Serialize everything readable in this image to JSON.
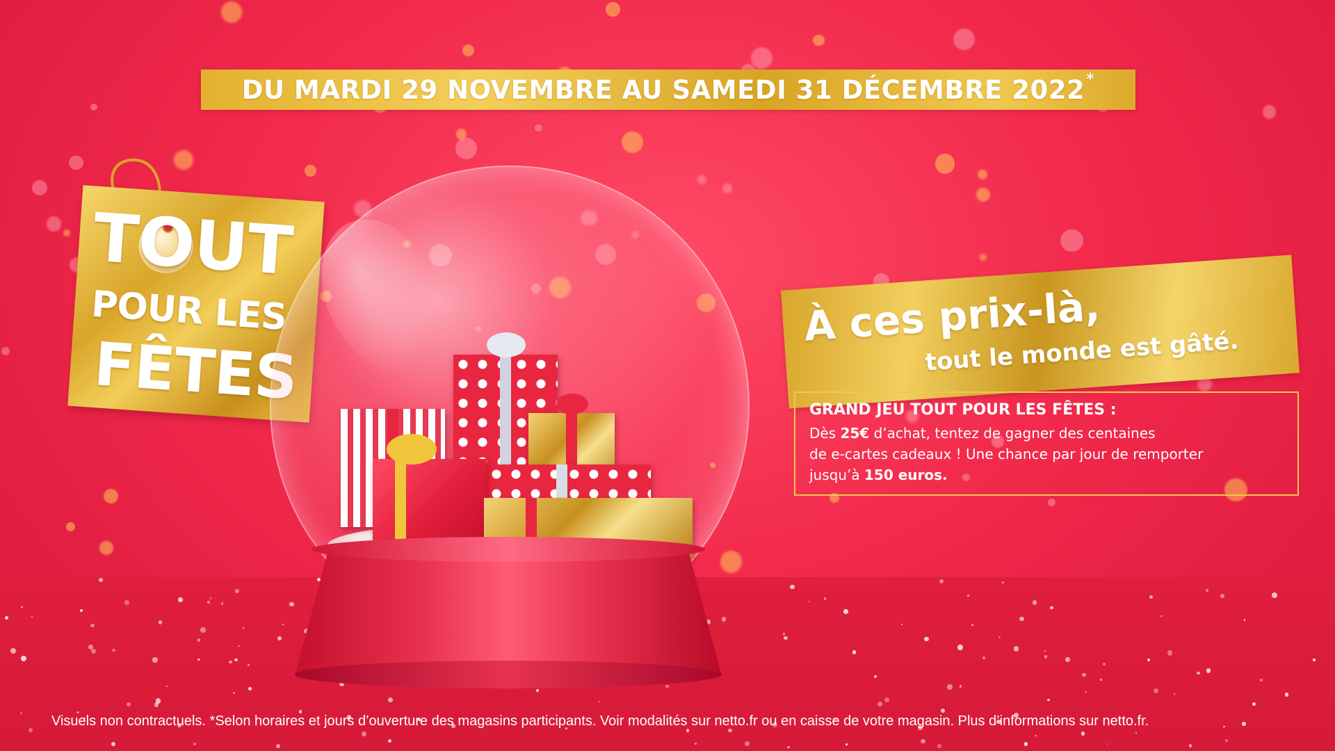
{
  "banner": {
    "date_text": "DU MARDI 29 NOVEMBRE AU SAMEDI 31 DÉCEMBRE 2022",
    "asterisk": "*"
  },
  "tag": {
    "line1": "TOUT",
    "line2": "POUR LES",
    "line3": "FÊTES"
  },
  "slogan": {
    "line1": "À ces prix-là,",
    "line2": "tout le monde est gâté."
  },
  "game": {
    "title": "GRAND JEU TOUT POUR LES FÊTES :",
    "line1_pre": "Dès ",
    "line1_amount": "25€",
    "line1_post": " d’achat, tentez de gagner des centaines",
    "line2": "de e-cartes cadeaux ! Une chance par jour de remporter",
    "line3_pre": "jusqu’à ",
    "line3_amount": "150 euros."
  },
  "footer": {
    "text": "Visuels non contractuels. *Selon horaires et jours d’ouverture des magasins participants. Voir modalités sur netto.fr ou en caisse de votre magasin. Plus d’informations sur netto.fr."
  },
  "colors": {
    "background_red": "#f22a4c",
    "gold": "#e3b12e",
    "text_white": "#ffffff"
  }
}
